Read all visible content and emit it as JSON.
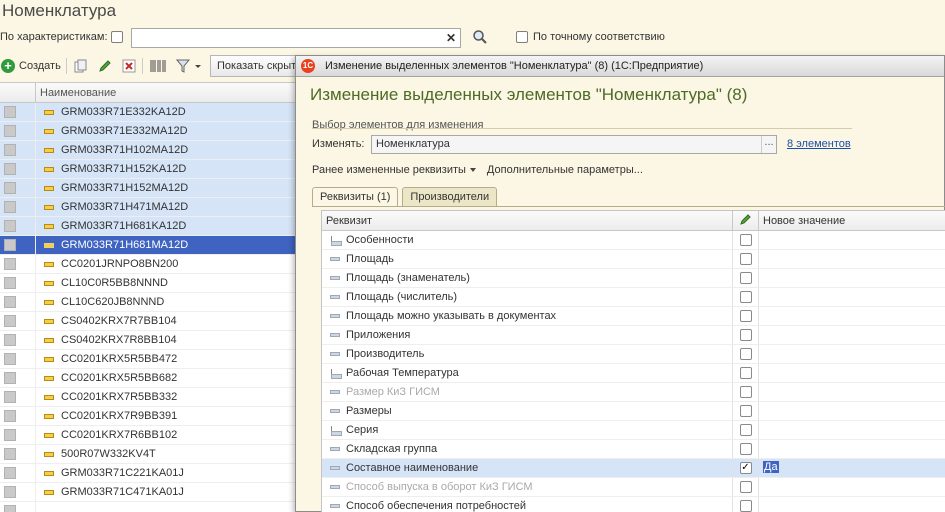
{
  "form": {
    "title": "Номенклатура",
    "filter_label": "По характеристикам:",
    "filter_value": "",
    "exact_match_label": "По точному соответствию",
    "toolbar": {
      "create_label": "Создать",
      "show_hidden_label": "Показать скрыт"
    },
    "list_header": "Наименование",
    "list_items": [
      {
        "name": "GRM033R71E332KA12D",
        "state": "selected"
      },
      {
        "name": "GRM033R71E332MA12D",
        "state": "selected"
      },
      {
        "name": "GRM033R71H102MA12D",
        "state": "selected"
      },
      {
        "name": "GRM033R71H152KA12D",
        "state": "selected"
      },
      {
        "name": "GRM033R71H152MA12D",
        "state": "selected"
      },
      {
        "name": "GRM033R71H471MA12D",
        "state": "selected"
      },
      {
        "name": "GRM033R71H681KA12D",
        "state": "selected"
      },
      {
        "name": "GRM033R71H681MA12D",
        "state": "current"
      },
      {
        "name": "CC0201JRNPO8BN200",
        "state": "none"
      },
      {
        "name": "CL10C0R5BB8NNND",
        "state": "none"
      },
      {
        "name": "CL10C620JB8NNND",
        "state": "none"
      },
      {
        "name": "CS0402KRX7R7BB104",
        "state": "none"
      },
      {
        "name": "CS0402KRX7R8BB104",
        "state": "none"
      },
      {
        "name": "CC0201KRX5R5BB472",
        "state": "none"
      },
      {
        "name": "CC0201KRX5R5BB682",
        "state": "none"
      },
      {
        "name": "CC0201KRX7R5BB332",
        "state": "none"
      },
      {
        "name": "CC0201KRX7R9BB391",
        "state": "none"
      },
      {
        "name": "CC0201KRX7R6BB102",
        "state": "none"
      },
      {
        "name": "500R07W332KV4T",
        "state": "none"
      },
      {
        "name": "GRM033R71C221KA01J",
        "state": "none"
      },
      {
        "name": "GRM033R71C471KA01J",
        "state": "none"
      },
      {
        "name": "",
        "state": "none"
      }
    ]
  },
  "dialog": {
    "window_title": "Изменение выделенных элементов \"Номенклатура\" (8)  (1С:Предприятие)",
    "app_icon_text": "1С",
    "heading": "Изменение выделенных элементов \"Номенклатура\" (8)",
    "selection_group_label": "Выбор элементов для изменения",
    "change_label": "Изменять:",
    "change_value": "Номенклатура",
    "change_button": "...",
    "elements_link": "8 элементов",
    "changed_attrs_label": "Ранее измененные реквизиты",
    "extra_params_label": "Дополнительные параметры...",
    "tabs": [
      {
        "label": "Реквизиты (1)",
        "active": true
      },
      {
        "label": "Производители",
        "active": false
      }
    ],
    "table_headers": {
      "attribute": "Реквизит",
      "new_value": "Новое значение"
    },
    "attributes": [
      {
        "name": "Особенности",
        "icon": "tree",
        "checked": false,
        "value": "",
        "disabled": false,
        "selected": false
      },
      {
        "name": "Площадь",
        "icon": "dash",
        "checked": false,
        "value": "",
        "disabled": false,
        "selected": false
      },
      {
        "name": "Площадь (знаменатель)",
        "icon": "dash",
        "checked": false,
        "value": "",
        "disabled": false,
        "selected": false
      },
      {
        "name": "Площадь (числитель)",
        "icon": "dash",
        "checked": false,
        "value": "",
        "disabled": false,
        "selected": false
      },
      {
        "name": "Площадь можно указывать в документах",
        "icon": "dash",
        "checked": false,
        "value": "",
        "disabled": false,
        "selected": false
      },
      {
        "name": "Приложения",
        "icon": "dash",
        "checked": false,
        "value": "",
        "disabled": false,
        "selected": false
      },
      {
        "name": "Производитель",
        "icon": "dash",
        "checked": false,
        "value": "",
        "disabled": false,
        "selected": false
      },
      {
        "name": "Рабочая Температура",
        "icon": "tree",
        "checked": false,
        "value": "",
        "disabled": false,
        "selected": false
      },
      {
        "name": "Размер КиЗ ГИСМ",
        "icon": "dash",
        "checked": false,
        "value": "",
        "disabled": true,
        "selected": false
      },
      {
        "name": "Размеры",
        "icon": "dash",
        "checked": false,
        "value": "",
        "disabled": false,
        "selected": false
      },
      {
        "name": "Серия",
        "icon": "tree",
        "checked": false,
        "value": "",
        "disabled": false,
        "selected": false
      },
      {
        "name": "Складская группа",
        "icon": "dash",
        "checked": false,
        "value": "",
        "disabled": false,
        "selected": false
      },
      {
        "name": "Составное наименование",
        "icon": "dash",
        "checked": true,
        "value": "Да",
        "disabled": false,
        "selected": true
      },
      {
        "name": "Способ выпуска в оборот КиЗ ГИСМ",
        "icon": "dash",
        "checked": false,
        "value": "",
        "disabled": true,
        "selected": false
      },
      {
        "name": "Способ обеспечения потребностей",
        "icon": "dash",
        "checked": false,
        "value": "",
        "disabled": false,
        "selected": false
      }
    ]
  }
}
